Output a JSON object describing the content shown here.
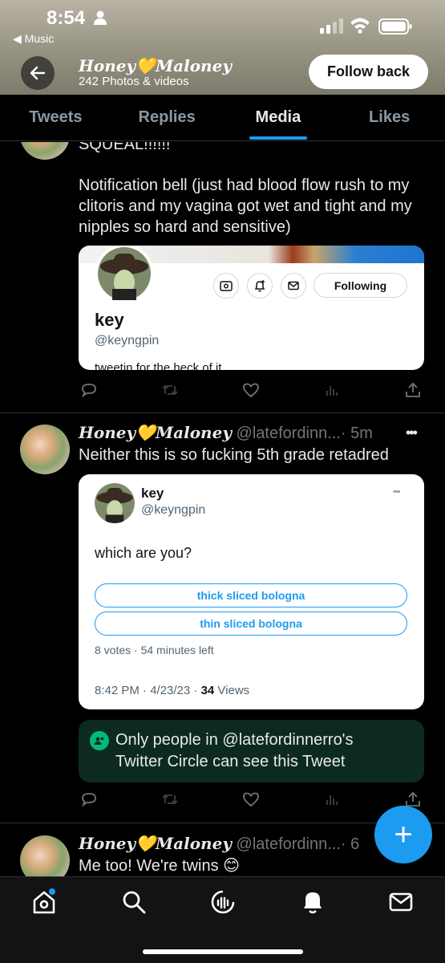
{
  "status_bar": {
    "time": "8:54",
    "back_app": "◀ Music"
  },
  "profile_header": {
    "name": "Honey💛Maloney",
    "media_count": "242 Photos & videos",
    "follow_back_label": "Follow back"
  },
  "tabs": [
    {
      "label": "Tweets",
      "active": false
    },
    {
      "label": "Replies",
      "active": false
    },
    {
      "label": "Media",
      "active": true
    },
    {
      "label": "Likes",
      "active": false
    }
  ],
  "tweet1": {
    "text_top": "SQUEAL!!!!!!",
    "text": "Notification bell (just had blood flow rush to my clitoris and my vagina got wet and tight and my nipples so hard and sensitive)",
    "card": {
      "name": "key",
      "handle": "@keyngpin",
      "bio": "tweetin for the heck of it",
      "following_label": "Following"
    }
  },
  "tweet2": {
    "name": "Honey💛Maloney",
    "handle": "@latefordinn...",
    "time": "· 5m",
    "more": "•••",
    "text": "Neither this is so fucking 5th grade retadred",
    "quoted": {
      "name": "key",
      "handle": "@keyngpin",
      "more": "•••",
      "question": "which are you?",
      "options": [
        "thick sliced bologna",
        "thin sliced bologna"
      ],
      "poll_meta": "8 votes · 54 minutes left",
      "timestamp": "8:42 PM · 4/23/23 · ",
      "views_count": "34",
      "views_label": " Views"
    },
    "circle_notice": "Only people in @latefordinnerro's Twitter Circle can see this Tweet"
  },
  "tweet3": {
    "name": "Honey💛Maloney",
    "handle": "@latefordinn...",
    "time": "· 6",
    "text": "Me too! We're twins 😊"
  },
  "fab_label": "+",
  "colors": {
    "accent": "#1d9bf0",
    "background": "#000000",
    "circle_green": "#0c2a21"
  }
}
